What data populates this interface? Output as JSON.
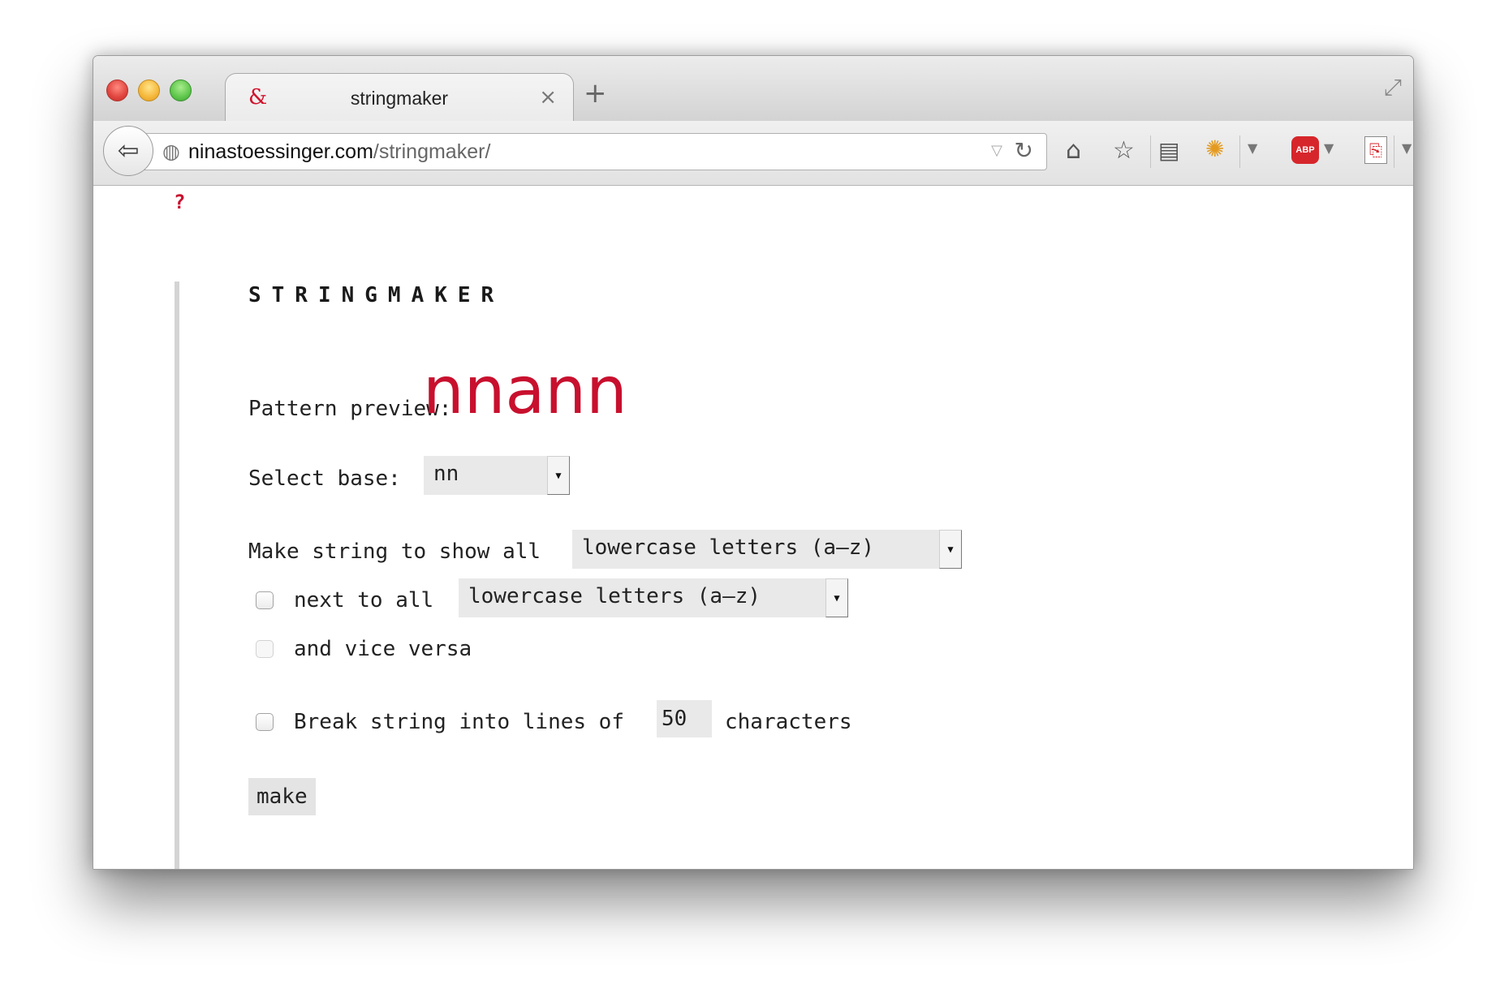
{
  "browser": {
    "tab_title": "stringmaker",
    "tab_favicon": "&",
    "tab_close": "×",
    "new_tab": "+",
    "url_host": "ninastoessinger.com",
    "url_path": "/stringmaker/",
    "toolbar_icons": [
      "back-icon",
      "globe-icon",
      "reload-icon",
      "home-icon",
      "star-icon",
      "reading-list-icon",
      "firebug-icon",
      "adblock-plus-icon",
      "pdf-icon",
      "menu-icon"
    ],
    "abp_label": "ABP"
  },
  "page": {
    "help_link": "?",
    "title": "STRINGMAKER",
    "preview_label": "Pattern preview:",
    "preview_value": "nnann",
    "base_label": "Select base:",
    "base_value": "nn",
    "show_all_label": "Make string to show all",
    "show_all_value": "lowercase letters (a–z)",
    "next_to_label": "next to all",
    "next_to_value": "lowercase letters (a–z)",
    "next_to_checked": false,
    "vice_versa_label": "and vice versa",
    "vice_versa_enabled": false,
    "break_label": "Break string into lines of",
    "break_value": "50",
    "break_suffix": "characters",
    "break_checked": false,
    "make_button": "make"
  },
  "colors": {
    "accent": "#c8102e",
    "input_bg": "#e9e9e9"
  }
}
